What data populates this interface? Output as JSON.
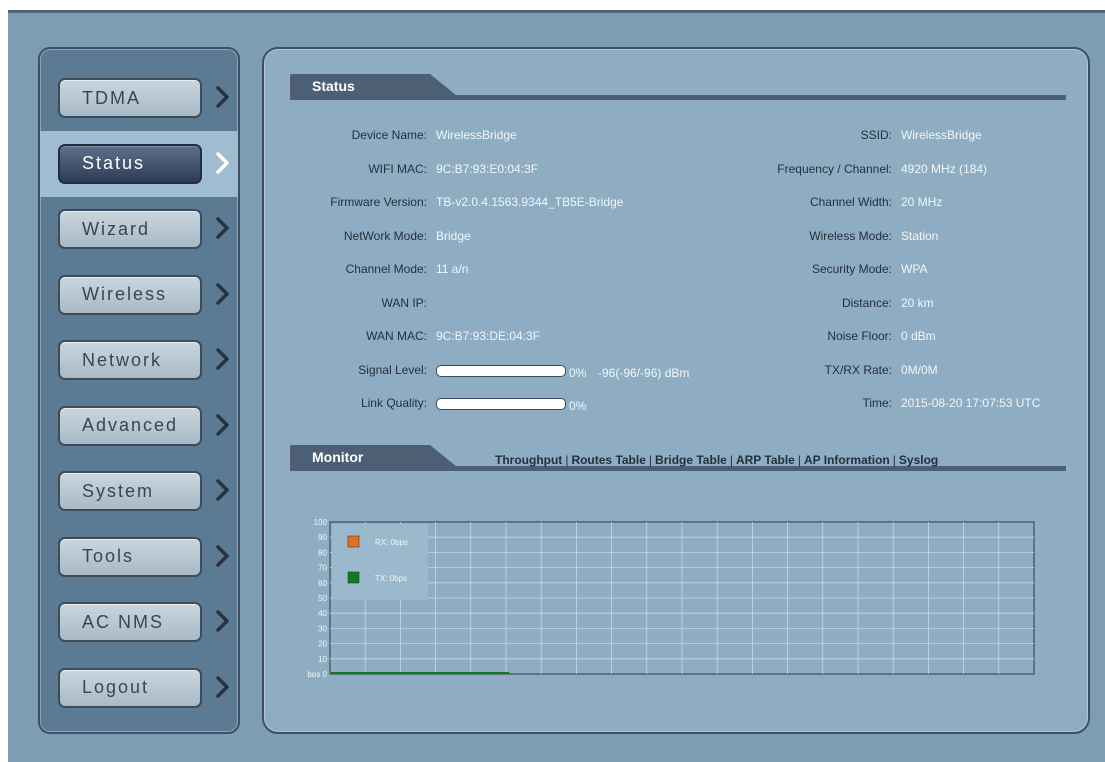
{
  "sidebar": {
    "items": [
      {
        "label": "TDMA",
        "active": false
      },
      {
        "label": "Status",
        "active": true
      },
      {
        "label": "Wizard",
        "active": false
      },
      {
        "label": "Wireless",
        "active": false
      },
      {
        "label": "Network",
        "active": false
      },
      {
        "label": "Advanced",
        "active": false
      },
      {
        "label": "System",
        "active": false
      },
      {
        "label": "Tools",
        "active": false
      },
      {
        "label": "AC NMS",
        "active": false
      },
      {
        "label": "Logout",
        "active": false
      }
    ]
  },
  "status": {
    "title": "Status",
    "left": [
      {
        "label": "Device Name:",
        "value": "WirelessBridge"
      },
      {
        "label": "WIFI MAC:",
        "value": "9C:B7:93:E0:04:3F"
      },
      {
        "label": "Firmware Version:",
        "value": "TB-v2.0.4.1563.9344_TB5E-Bridge"
      },
      {
        "label": "NetWork Mode:",
        "value": "Bridge"
      },
      {
        "label": "Channel Mode:",
        "value": "11 a/n"
      },
      {
        "label": "WAN IP:",
        "value": ""
      },
      {
        "label": "WAN MAC:",
        "value": "9C:B7:93:DE:04:3F"
      }
    ],
    "signal": {
      "label": "Signal Level:",
      "percent": 0,
      "percent_text": "0%",
      "dbm_text": "-96(-96/-96) dBm"
    },
    "link": {
      "label": "Link Quality:",
      "percent": 0,
      "percent_text": "0%"
    },
    "right": [
      {
        "label": "SSID:",
        "value": "WirelessBridge"
      },
      {
        "label": "Frequency / Channel:",
        "value": "4920 MHz (184)"
      },
      {
        "label": "Channel Width:",
        "value": "20 MHz"
      },
      {
        "label": "Wireless Mode:",
        "value": "Station"
      },
      {
        "label": "Security Mode:",
        "value": "WPA"
      },
      {
        "label": "Distance:",
        "value": "20 km"
      },
      {
        "label": "Noise Floor:",
        "value": "0 dBm"
      },
      {
        "label": "TX/RX Rate:",
        "value": "0M/0M"
      },
      {
        "label": "Time:",
        "value": "2015-08-20 17:07:53 UTC"
      }
    ]
  },
  "monitor": {
    "title": "Monitor",
    "links": [
      "Throughput",
      "Routes Table",
      "Bridge Table",
      "ARP Table",
      "AP Information",
      "Syslog"
    ]
  },
  "chart_data": {
    "type": "line",
    "y_ticks": [
      "100",
      "90",
      "80",
      "70",
      "60",
      "50",
      "40",
      "30",
      "20",
      "10",
      "bps 0"
    ],
    "ylim": [
      0,
      100
    ],
    "grid": true,
    "legend_placement": "top-left",
    "series": [
      {
        "name": "RX: 0bps",
        "color": "#e2711d",
        "values": [
          0,
          0,
          0,
          0,
          0,
          0
        ]
      },
      {
        "name": "TX: 0bps",
        "color": "#0d7a1e",
        "values": [
          0,
          0,
          0,
          0,
          0,
          0
        ]
      }
    ]
  },
  "colors": {
    "frame": "#7d9db4",
    "panel": "#8eadc3",
    "sidebar": "#5b7a93",
    "active_item": "#9fbcd0",
    "header_tab": "#4c5f74"
  }
}
